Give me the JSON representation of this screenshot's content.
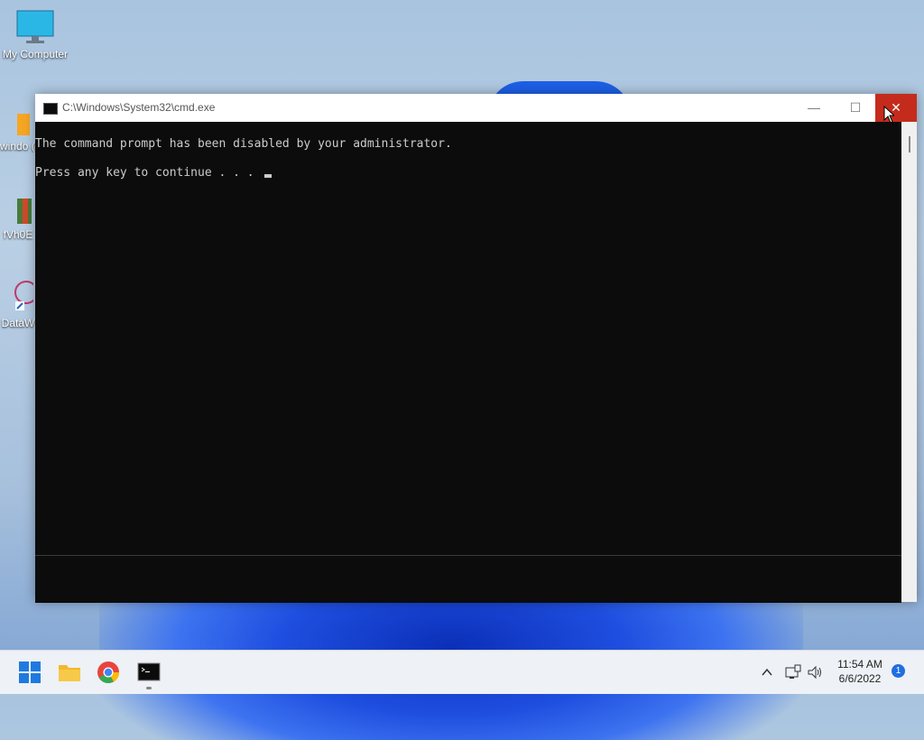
{
  "desktop": {
    "icons": [
      {
        "label": "My Computer"
      },
      {
        "label": "windo (1)."
      },
      {
        "label": "fVh0E"
      },
      {
        "label": "DataW"
      }
    ]
  },
  "window": {
    "title": "C:\\Windows\\System32\\cmd.exe",
    "minimize_label": "—",
    "maximize_label": "☐",
    "close_label": "✕",
    "lines": [
      "The command prompt has been disabled by your administrator.",
      "Press any key to continue . . . "
    ]
  },
  "taskbar": {
    "apps": [
      "start-icon",
      "file-explorer-icon",
      "chrome-icon",
      "terminal-icon"
    ],
    "time": "11:54 AM",
    "date": "6/6/2022",
    "notification_count": "1"
  }
}
